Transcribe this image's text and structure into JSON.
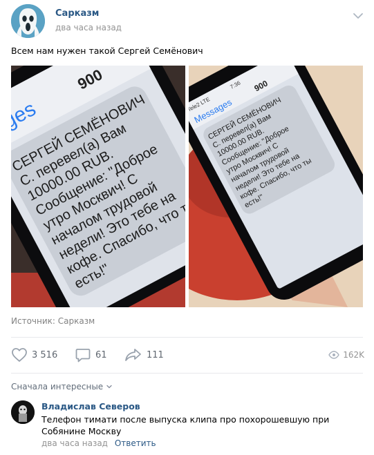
{
  "post": {
    "author": "Сарказм",
    "time": "два часа назад",
    "text": "Всем нам нужен такой Сергей Семёнович",
    "source_label": "Источник:",
    "source_name": "Сарказм"
  },
  "photos": {
    "left": {
      "header_app": "sages",
      "sender": "900",
      "sms_lines": [
        "СЕРГЕЙ СЕМЁНОВИЧ",
        "С. перевел(а) Вам",
        "10000.00 RUB.",
        "Сообщение: \"Доброе",
        "утро Москвич! С",
        "началом трудовой",
        "недели! Это тебе на",
        "кофе. Спасибо, что ты",
        "есть!\""
      ]
    },
    "right": {
      "status": "Tele2 LTE",
      "clock": "7:36",
      "header_app": "Messages",
      "sender": "900",
      "sms_lines": [
        "СЕРГЕЙ СЕМЁНОВИЧ",
        "С. перевел(а) Вам",
        "10000.00 RUB.",
        "Сообщение: \"Доброе",
        "утро Москвич! С",
        "началом трудовой",
        "недели! Это тебе на",
        "кофе. Спасибо, что ты",
        "есть!\""
      ]
    }
  },
  "actions": {
    "likes": "3 516",
    "comments": "61",
    "shares": "111",
    "views": "162K"
  },
  "comments": {
    "sort_label": "Сначала интересные",
    "items": [
      {
        "author": "Владислав Северов",
        "text": "Телефон тимати после выпуска клипа про похорошевшую при Собянине Москву",
        "time": "два часа назад",
        "reply_label": "Ответить"
      }
    ]
  },
  "icons": {
    "like": "heart-icon",
    "comment": "comment-bubble-icon",
    "share": "share-arrow-icon",
    "views": "eye-icon",
    "menu": "chevron-down-icon",
    "sort": "chevron-down-icon"
  },
  "colors": {
    "link": "#2a5885",
    "muted": "#939393",
    "action": "#606770",
    "divider": "#e7e8ec"
  }
}
